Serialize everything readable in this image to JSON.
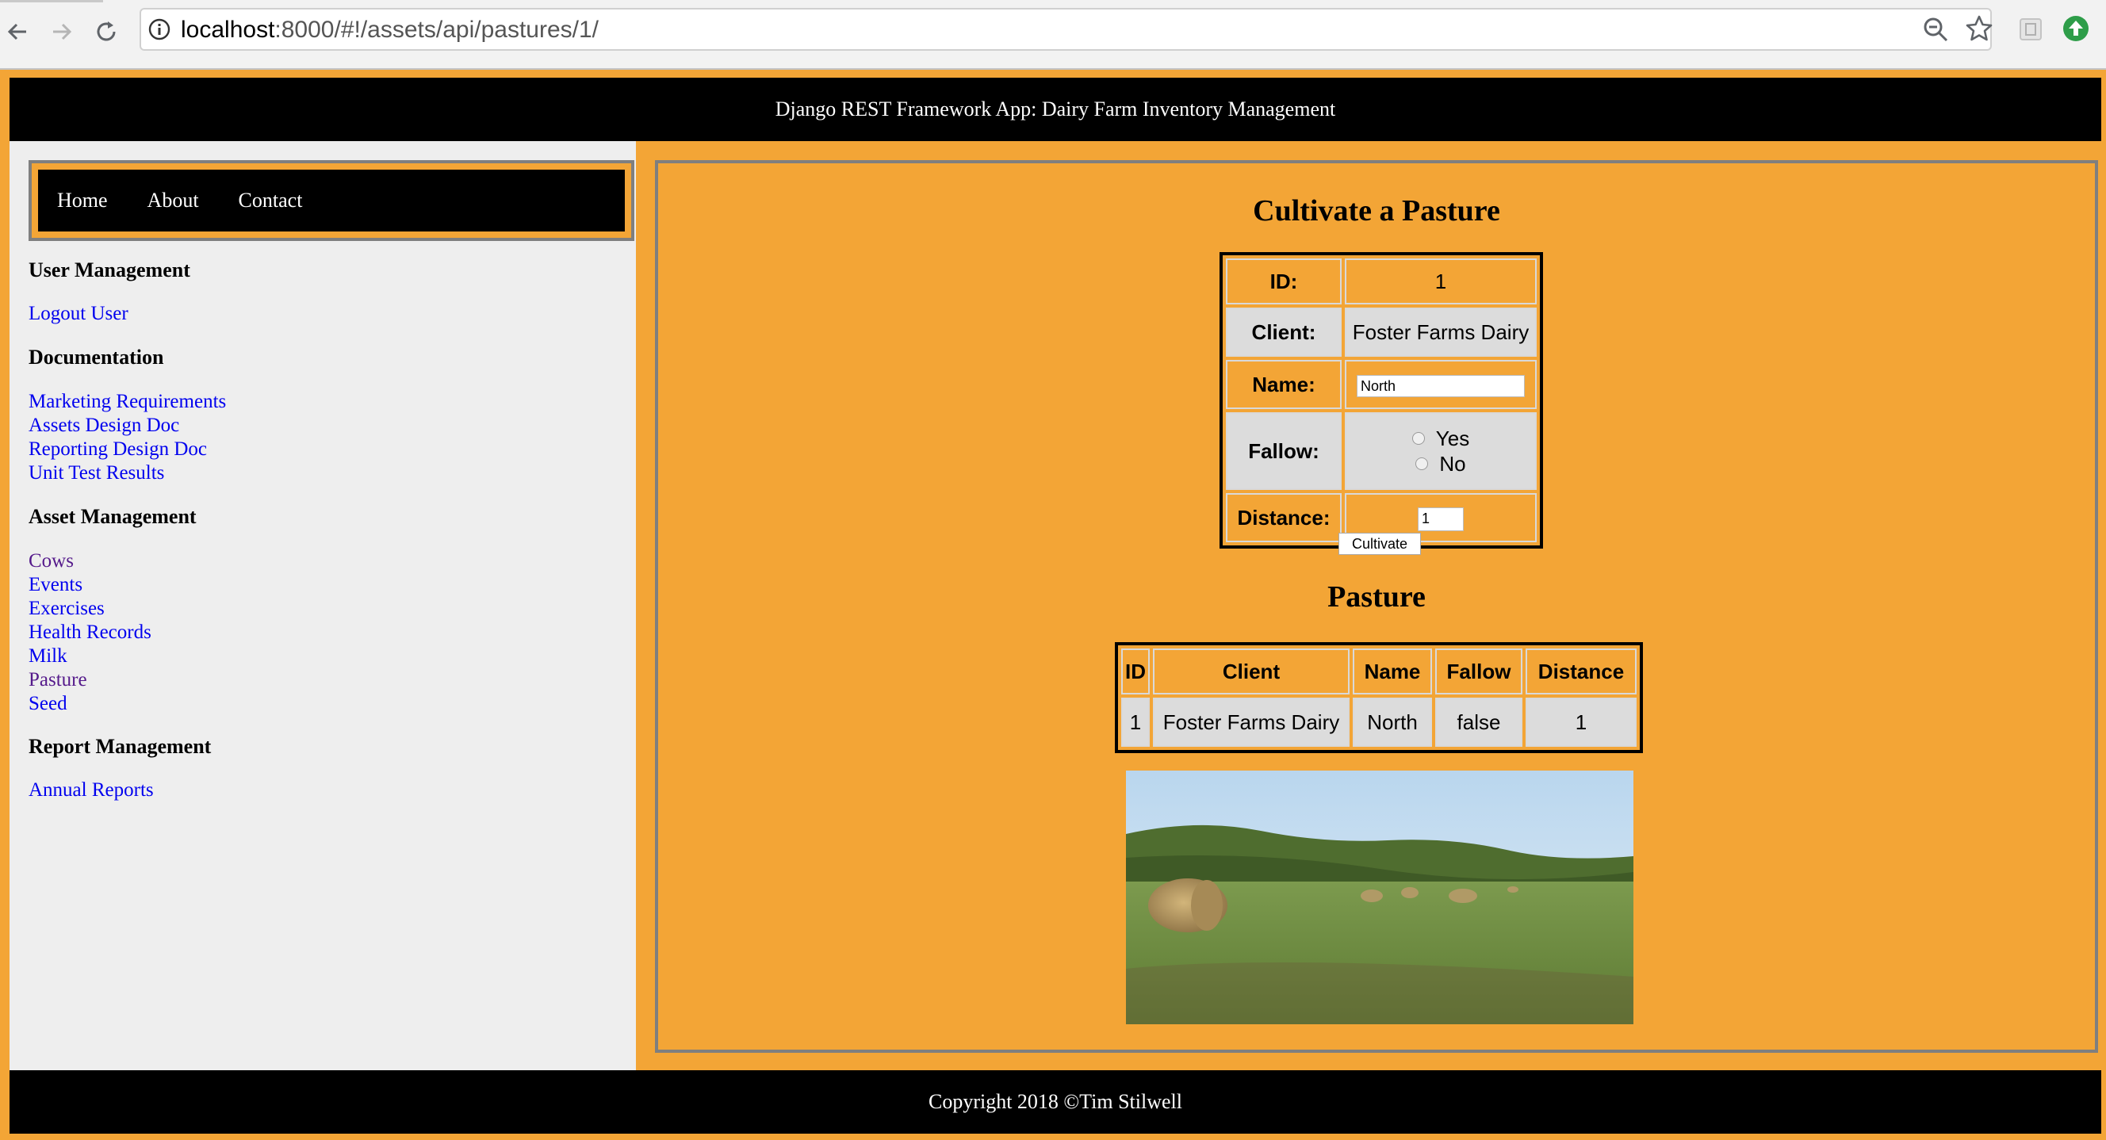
{
  "browser": {
    "url_host": "localhost",
    "url_path": ":8000/#!/assets/api/pastures/1/"
  },
  "header": {
    "title": "Django REST Framework App: Dairy Farm Inventory Management"
  },
  "topnav": {
    "items": [
      "Home",
      "About",
      "Contact"
    ]
  },
  "sidebar": {
    "user_management": {
      "heading": "User Management",
      "links": [
        "Logout User"
      ]
    },
    "documentation": {
      "heading": "Documentation",
      "links": [
        "Marketing Requirements",
        "Assets Design Doc",
        "Reporting Design Doc",
        "Unit Test Results"
      ]
    },
    "asset_management": {
      "heading": "Asset Management",
      "links": [
        "Cows",
        "Events",
        "Exercises",
        "Health Records",
        "Milk",
        "Pasture",
        "Seed"
      ]
    },
    "report_management": {
      "heading": "Report Management",
      "links": [
        "Annual Reports"
      ]
    }
  },
  "form": {
    "title": "Cultivate a Pasture",
    "id_label": "ID:",
    "id_value": "1",
    "client_label": "Client:",
    "client_value": "Foster Farms Dairy",
    "name_label": "Name:",
    "name_value": "North",
    "fallow_label": "Fallow:",
    "fallow_options": [
      "Yes",
      "No"
    ],
    "distance_label": "Distance:",
    "distance_value": "1",
    "submit_label": "Cultivate"
  },
  "pasture_table": {
    "title": "Pasture",
    "columns": [
      "ID",
      "Client",
      "Name",
      "Fallow",
      "Distance"
    ],
    "rows": [
      [
        "1",
        "Foster Farms Dairy",
        "North",
        "false",
        "1"
      ]
    ]
  },
  "footer": {
    "text": "Copyright 2018 ©Tim Stilwell"
  },
  "colors": {
    "page_bg": "#f3a536",
    "bar_bg": "#000000",
    "sidebar_bg": "#eeeeee",
    "link": "#0000ee"
  }
}
